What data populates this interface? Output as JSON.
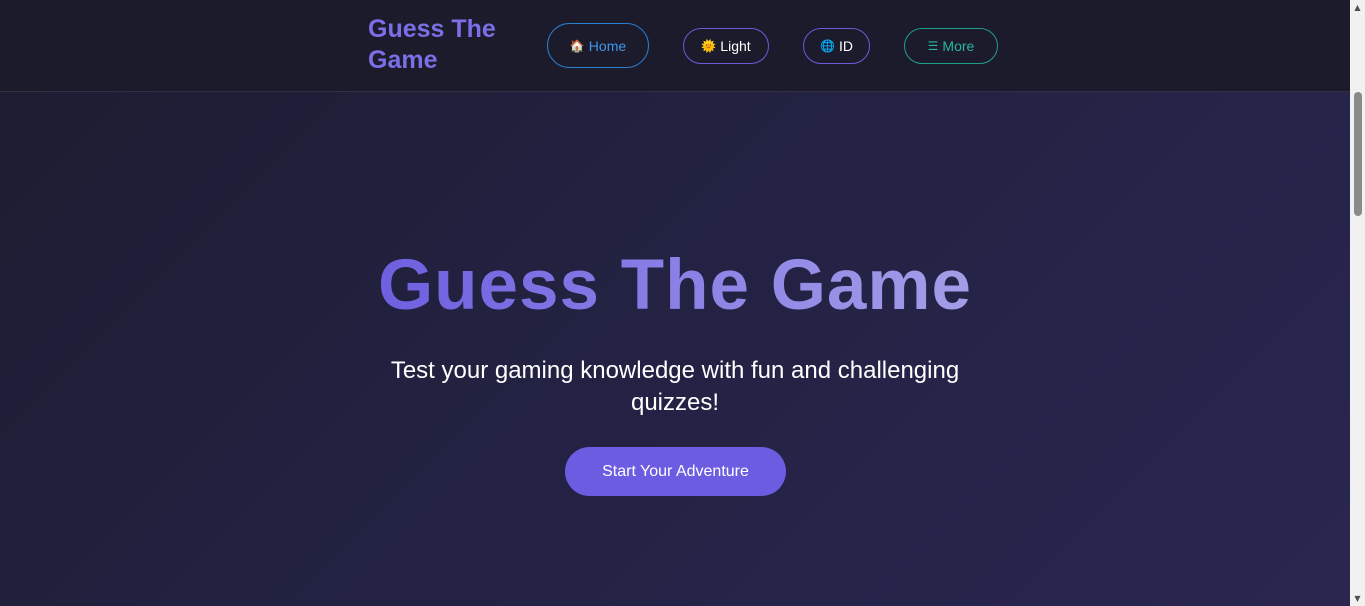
{
  "nav": {
    "brand": "Guess The Game",
    "items": [
      {
        "icon": "🏠",
        "icon_name": "house-icon",
        "label": "Home"
      },
      {
        "icon": "🌞",
        "icon_name": "sun-icon",
        "label": "Light"
      },
      {
        "icon": "🌐",
        "icon_name": "globe-icon",
        "label": "ID"
      },
      {
        "icon": "☰",
        "icon_name": "menu-icon",
        "label": "More"
      }
    ]
  },
  "hero": {
    "title": "Guess The Game",
    "subtitle": "Test your gaming knowledge with fun and challenging quizzes!",
    "cta_label": "Start Your Adventure"
  },
  "colors": {
    "accent": "#6c5ce2",
    "home": "#2a7fd0",
    "more": "#1f9e8a",
    "navbar_bg": "#1b1b2c"
  }
}
